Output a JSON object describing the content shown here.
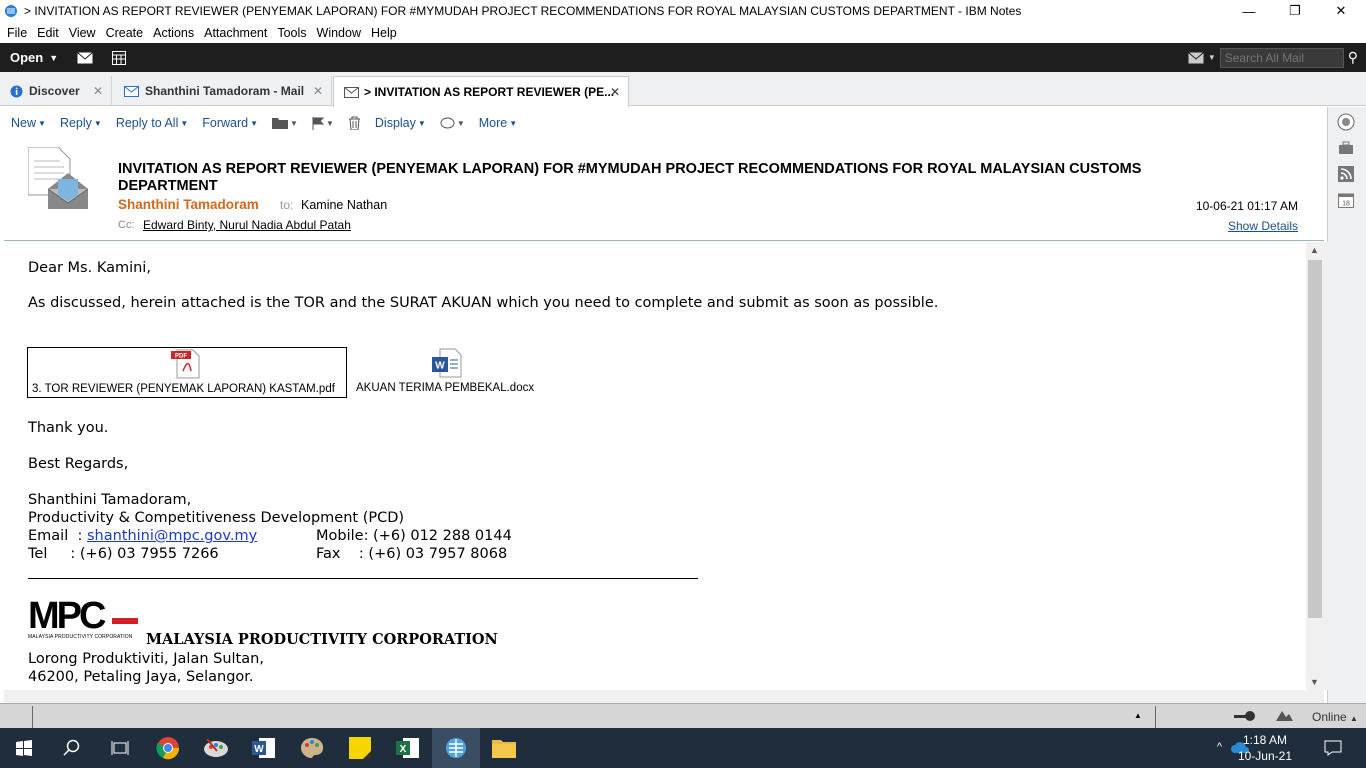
{
  "window": {
    "title": "> INVITATION AS REPORT REVIEWER (PENYEMAK LAPORAN) FOR #MYMUDAH PROJECT RECOMMENDATIONS FOR ROYAL MALAYSIAN CUSTOMS DEPARTMENT - IBM Notes"
  },
  "menu": [
    "File",
    "Edit",
    "View",
    "Create",
    "Actions",
    "Attachment",
    "Tools",
    "Window",
    "Help"
  ],
  "topbar": {
    "open_label": "Open",
    "search_placeholder": "Search All Mail"
  },
  "tabs": [
    {
      "label": "Discover"
    },
    {
      "label": "Shanthini Tamadoram - Mail"
    },
    {
      "label": "> INVITATION AS REPORT REVIEWER (PE..."
    }
  ],
  "toolbar": {
    "new": "New",
    "reply": "Reply",
    "reply_all": "Reply to All",
    "forward": "Forward",
    "display": "Display",
    "more": "More"
  },
  "email": {
    "subject": "INVITATION AS REPORT REVIEWER (PENYEMAK LAPORAN) FOR #MYMUDAH PROJECT RECOMMENDATIONS FOR ROYAL MALAYSIAN CUSTOMS DEPARTMENT",
    "sender": "Shanthini Tamadoram",
    "to_label": "to:",
    "to": "Kamine Nathan",
    "cc_label": "Cc:",
    "cc1": "Edward Binty",
    "cc2": "Nurul Nadia Abdul Patah",
    "date": "10-06-21 01:17 AM",
    "show_details": "Show Details",
    "greeting": "Dear Ms. Kamini,",
    "line1": "As discussed, herein attached is the TOR and the SURAT AKUAN which you need to complete and submit as soon as possible.",
    "attachment1": "3. TOR REVIEWER (PENYEMAK LAPORAN) KASTAM.pdf",
    "attachment2": "AKUAN TERIMA PEMBEKAL.docx",
    "thanks": "Thank you.",
    "regards": "Best Regards,",
    "sig_name": "Shanthini Tamadoram,",
    "sig_dept": "Productivity & Competitiveness Development (PCD)",
    "email_label": "Email  : ",
    "email_addr": "shanthini@mpc.gov.my",
    "mobile": "Mobile: (+6) 012 288 0144",
    "tel": "Tel     : (+6) 03 7955 7266",
    "fax": "Fax    : (+6) 03 7957 8068",
    "org": "MALAYSIA PRODUCTIVITY CORPORATION",
    "logo_text": "MPC",
    "logo_sub": "MALAYSIA PRODUCTIVITY CORPORATION",
    "addr1": "Lorong Produktiviti, Jalan Sultan,",
    "addr2": "46200, Petaling Jaya, Selangor."
  },
  "status": {
    "online": "Online"
  },
  "taskbar": {
    "time": "1:18 AM",
    "date": "10-Jun-21"
  }
}
